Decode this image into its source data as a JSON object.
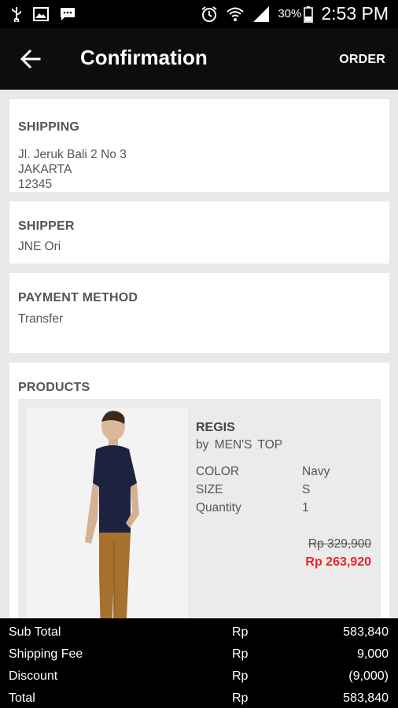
{
  "status_bar": {
    "time": "2:53 PM",
    "battery": "30%",
    "icons": [
      "usb-icon",
      "gallery-icon",
      "message-icon",
      "alarm-icon",
      "wifi-icon",
      "signal-icon",
      "battery-icon"
    ]
  },
  "app_bar": {
    "title": "Confirmation",
    "action": "ORDER",
    "back_icon": "arrow-back-icon"
  },
  "shipping": {
    "heading": "SHIPPING",
    "address_line1": "Jl. Jeruk Bali 2 No 3",
    "city": "JAKARTA",
    "postal_code": "12345"
  },
  "shipper": {
    "heading": "SHIPPER",
    "value": "JNE Ori"
  },
  "payment": {
    "heading": "PAYMENT METHOD",
    "value": "Transfer"
  },
  "products": {
    "heading": "PRODUCTS",
    "items": [
      {
        "name": "REGIS",
        "by_label": "by",
        "brand": "MEN'S TOP",
        "color_label": "COLOR",
        "color": "Navy",
        "size_label": "SIZE",
        "size": "S",
        "quantity_label": "Quantity",
        "quantity": "1",
        "original_price": "Rp 329,900",
        "price": "Rp 263,920"
      }
    ]
  },
  "summary": {
    "rows": [
      {
        "label": "Sub Total",
        "currency": "Rp",
        "value": "583,840"
      },
      {
        "label": "Shipping Fee",
        "currency": "Rp",
        "value": "9,000"
      },
      {
        "label": "Discount",
        "currency": "Rp",
        "value": "(9,000)"
      },
      {
        "label": "Total",
        "currency": "Rp",
        "value": "583,840"
      }
    ]
  },
  "colors": {
    "app_bar": "#0d0d0d",
    "background": "#e8e8e8",
    "sale_price": "#e8232c",
    "summary_bar": "#000000"
  }
}
